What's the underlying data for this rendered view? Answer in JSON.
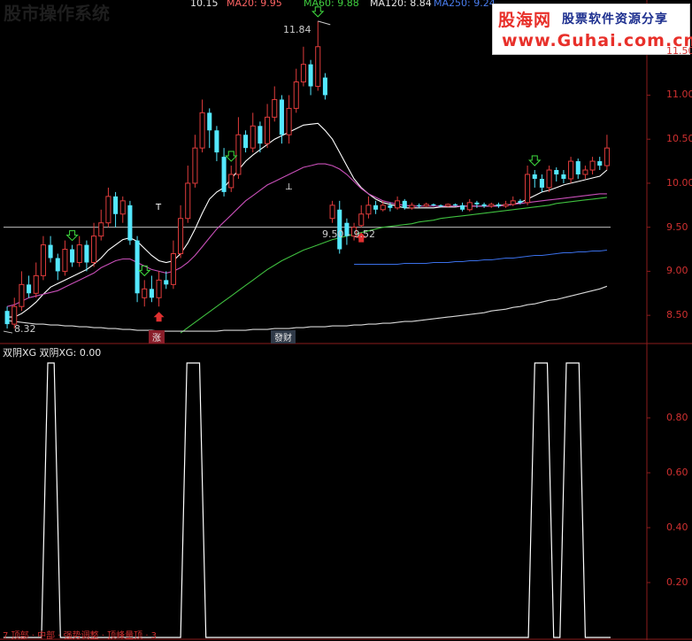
{
  "header": {
    "watermark_bg": "股市操作系统",
    "price_label": "10.15",
    "ma20": "MA20: 9.95",
    "ma60": "MA60: 9.88",
    "ma120": "MA120: 8.84",
    "ma250": "MA250: 9.24"
  },
  "logo": {
    "name": "股海网",
    "slogan": "股票软件资源分享",
    "url": "www.Guhai.com.cn"
  },
  "annotations": {
    "high_label": "11.84",
    "low_label": "8.32",
    "range_label": "9.50 - 9.52",
    "zhang_tag": "涨",
    "facai_tag": "發财",
    "t_mark": "T",
    "t_mark2": "⊥"
  },
  "lower_panel": {
    "title": "双阴XG  双阴XG: 0.00",
    "footer": "7 顶部 · 中部 · 强势调整 · 顶峰量顶 · 3"
  },
  "colors": {
    "bg": "#000000",
    "up": "#e03c3c",
    "down": "#54e8ff",
    "ma_white": "#ffffff",
    "ma_magenta": "#c84fb8",
    "ma_green": "#3fbf3f",
    "ma_blue": "#3a6fe8",
    "ma_gray": "#d8d8d8",
    "grid": "#8c1c1c",
    "tick": "#d03030",
    "arrow_green": "#3fdc3f",
    "arrow_red": "#e03030"
  },
  "chart_data": [
    {
      "type": "candlestick",
      "title": "",
      "ylim": [
        8.2,
        12.0
      ],
      "yticks": [
        8.5,
        9.0,
        9.5,
        10.0,
        10.5,
        11.0,
        11.5
      ],
      "ytick_labels": [
        "8.50",
        "9.00",
        "9.50",
        "10.00",
        "10.50",
        "11.00",
        "11.50"
      ],
      "candles": [
        [
          8.55,
          8.4,
          8.6,
          8.35
        ],
        [
          8.4,
          8.6,
          8.7,
          8.35
        ],
        [
          8.6,
          8.85,
          9.0,
          8.55
        ],
        [
          8.85,
          8.75,
          8.95,
          8.7
        ],
        [
          8.75,
          8.95,
          9.1,
          8.7
        ],
        [
          8.95,
          9.3,
          9.4,
          8.9
        ],
        [
          9.3,
          9.15,
          9.4,
          9.1
        ],
        [
          9.15,
          9.0,
          9.2,
          8.9
        ],
        [
          9.0,
          9.25,
          9.35,
          8.95
        ],
        [
          9.25,
          9.1,
          9.3,
          9.05
        ],
        [
          9.1,
          9.3,
          9.4,
          9.05
        ],
        [
          9.3,
          9.1,
          9.35,
          9.0
        ],
        [
          9.1,
          9.4,
          9.55,
          9.05
        ],
        [
          9.4,
          9.55,
          9.7,
          9.35
        ],
        [
          9.55,
          9.85,
          9.95,
          9.5
        ],
        [
          9.85,
          9.65,
          9.9,
          9.5
        ],
        [
          9.65,
          9.8,
          9.85,
          9.55
        ],
        [
          9.75,
          9.35,
          9.8,
          9.3
        ],
        [
          9.35,
          8.75,
          9.4,
          8.65
        ],
        [
          8.7,
          8.8,
          8.9,
          8.6
        ],
        [
          8.8,
          8.7,
          8.95,
          8.65
        ],
        [
          8.7,
          8.9,
          9.0,
          8.6
        ],
        [
          8.9,
          8.85,
          9.0,
          8.8
        ],
        [
          8.85,
          9.2,
          9.35,
          8.8
        ],
        [
          9.2,
          9.6,
          9.75,
          9.15
        ],
        [
          9.6,
          10.0,
          10.2,
          9.55
        ],
        [
          10.0,
          10.4,
          10.55,
          9.95
        ],
        [
          10.4,
          10.8,
          10.95,
          10.35
        ],
        [
          10.8,
          10.6,
          10.85,
          10.4
        ],
        [
          10.6,
          10.35,
          10.65,
          10.25
        ],
        [
          10.3,
          9.9,
          10.4,
          9.85
        ],
        [
          9.95,
          10.1,
          10.2,
          9.9
        ],
        [
          10.1,
          10.55,
          10.75,
          10.05
        ],
        [
          10.55,
          10.4,
          10.6,
          10.35
        ],
        [
          10.4,
          10.65,
          10.8,
          10.35
        ],
        [
          10.65,
          10.45,
          10.7,
          10.35
        ],
        [
          10.45,
          10.75,
          10.9,
          10.4
        ],
        [
          10.75,
          10.95,
          11.1,
          10.7
        ],
        [
          10.95,
          10.55,
          11.0,
          10.45
        ],
        [
          10.55,
          10.85,
          11.0,
          10.45
        ],
        [
          10.85,
          11.15,
          11.3,
          10.8
        ],
        [
          11.15,
          11.35,
          11.55,
          11.1
        ],
        [
          11.35,
          11.1,
          11.4,
          11.0
        ],
        [
          11.1,
          11.55,
          11.84,
          11.05
        ],
        [
          11.2,
          11.0,
          11.25,
          10.95
        ],
        [
          9.6,
          9.75,
          9.8,
          9.55
        ],
        [
          9.7,
          9.25,
          9.8,
          9.2
        ],
        [
          9.55,
          9.4,
          9.6,
          9.3
        ],
        [
          9.4,
          9.5,
          9.55,
          9.35
        ],
        [
          9.52,
          9.65,
          9.75,
          9.5
        ],
        [
          9.65,
          9.75,
          9.85,
          9.6
        ],
        [
          9.75,
          9.7,
          9.8,
          9.65
        ],
        [
          9.7,
          9.75,
          9.8,
          9.68
        ],
        [
          9.75,
          9.72,
          9.78,
          9.68
        ],
        [
          9.72,
          9.8,
          9.85,
          9.7
        ],
        [
          9.8,
          9.72,
          9.82,
          9.7
        ],
        [
          9.72,
          9.75,
          9.78,
          9.7
        ],
        [
          9.75,
          9.74,
          9.77,
          9.72
        ],
        [
          9.74,
          9.76,
          9.78,
          9.73
        ],
        [
          9.76,
          9.75,
          9.77,
          9.74
        ],
        [
          9.75,
          9.74,
          9.76,
          9.73
        ],
        [
          9.74,
          9.76,
          9.77,
          9.73
        ],
        [
          9.76,
          9.75,
          9.77,
          9.74
        ],
        [
          9.75,
          9.7,
          9.78,
          9.68
        ],
        [
          9.7,
          9.78,
          9.82,
          9.68
        ],
        [
          9.78,
          9.76,
          9.8,
          9.72
        ],
        [
          9.76,
          9.74,
          9.78,
          9.72
        ],
        [
          9.74,
          9.76,
          9.78,
          9.72
        ],
        [
          9.76,
          9.74,
          9.78,
          9.72
        ],
        [
          9.74,
          9.76,
          9.8,
          9.72
        ],
        [
          9.76,
          9.8,
          9.85,
          9.74
        ],
        [
          9.8,
          9.78,
          9.82,
          9.76
        ],
        [
          9.78,
          10.1,
          10.2,
          9.75
        ],
        [
          10.1,
          10.05,
          10.15,
          9.95
        ],
        [
          10.05,
          9.95,
          10.1,
          9.9
        ],
        [
          9.95,
          10.15,
          10.2,
          9.9
        ],
        [
          10.15,
          10.1,
          10.18,
          10.02
        ],
        [
          10.1,
          10.05,
          10.15,
          10.0
        ],
        [
          10.05,
          10.25,
          10.3,
          10.0
        ],
        [
          10.25,
          10.1,
          10.28,
          10.05
        ],
        [
          10.1,
          10.15,
          10.2,
          10.05
        ],
        [
          10.15,
          10.25,
          10.3,
          10.1
        ],
        [
          10.25,
          10.2,
          10.3,
          10.15
        ],
        [
          10.2,
          10.4,
          10.55,
          10.15
        ]
      ],
      "series": [
        {
          "name": "MA20",
          "values": [
            8.48,
            8.48,
            8.52,
            8.58,
            8.65,
            8.74,
            8.82,
            8.86,
            8.9,
            8.94,
            8.98,
            9.02,
            9.08,
            9.15,
            9.24,
            9.3,
            9.36,
            9.38,
            9.34,
            9.26,
            9.18,
            9.12,
            9.1,
            9.12,
            9.2,
            9.32,
            9.48,
            9.66,
            9.82,
            9.9,
            9.95,
            10.05,
            10.15,
            10.25,
            10.32,
            10.38,
            10.44,
            10.5,
            10.54,
            10.58,
            10.62,
            10.66,
            10.67,
            10.68,
            10.6,
            10.5,
            10.35,
            10.2,
            10.05,
            9.95,
            9.88,
            9.82,
            9.78,
            9.76,
            9.74,
            9.72,
            9.72,
            9.72,
            9.72,
            9.72,
            9.73,
            9.73,
            9.73,
            9.74,
            9.74,
            9.74,
            9.74,
            9.74,
            9.75,
            9.75,
            9.76,
            9.78,
            9.82,
            9.86,
            9.9,
            9.92,
            9.95,
            9.98,
            10.0,
            10.02,
            10.04,
            10.06,
            10.08,
            10.15
          ]
        },
        {
          "name": "MA60",
          "values": [
            8.6,
            8.62,
            8.66,
            8.7,
            8.72,
            8.74,
            8.76,
            8.78,
            8.82,
            8.86,
            8.9,
            8.94,
            8.98,
            9.04,
            9.08,
            9.12,
            9.14,
            9.14,
            9.1,
            9.06,
            9.02,
            9.0,
            8.98,
            9.0,
            9.04,
            9.1,
            9.18,
            9.28,
            9.38,
            9.48,
            9.56,
            9.64,
            9.72,
            9.8,
            9.86,
            9.92,
            9.98,
            10.02,
            10.06,
            10.1,
            10.14,
            10.18,
            10.2,
            10.22,
            10.22,
            10.2,
            10.16,
            10.1,
            10.02,
            9.94,
            9.88,
            9.84,
            9.8,
            9.78,
            9.76,
            9.75,
            9.74,
            9.74,
            9.74,
            9.74,
            9.74,
            9.74,
            9.74,
            9.74,
            9.74,
            9.74,
            9.74,
            9.74,
            9.74,
            9.75,
            9.76,
            9.77,
            9.78,
            9.79,
            9.8,
            9.81,
            9.82,
            9.83,
            9.84,
            9.85,
            9.86,
            9.87,
            9.88,
            9.88
          ]
        },
        {
          "name": "MA120",
          "values": [
            null,
            null,
            null,
            null,
            null,
            null,
            null,
            null,
            null,
            null,
            null,
            null,
            null,
            null,
            null,
            null,
            null,
            null,
            null,
            null,
            null,
            null,
            null,
            null,
            8.3,
            8.36,
            8.42,
            8.48,
            8.54,
            8.6,
            8.66,
            8.72,
            8.78,
            8.84,
            8.9,
            8.96,
            9.02,
            9.07,
            9.12,
            9.16,
            9.2,
            9.24,
            9.27,
            9.3,
            9.33,
            9.36,
            9.38,
            9.4,
            9.42,
            9.44,
            9.46,
            9.48,
            9.5,
            9.51,
            9.52,
            9.53,
            9.54,
            9.56,
            9.57,
            9.58,
            9.6,
            9.61,
            9.62,
            9.63,
            9.64,
            9.65,
            9.66,
            9.67,
            9.68,
            9.69,
            9.7,
            9.71,
            9.72,
            9.73,
            9.74,
            9.75,
            9.77,
            9.78,
            9.79,
            9.8,
            9.81,
            9.82,
            9.83,
            9.84
          ]
        },
        {
          "name": "MA250",
          "values": [
            null,
            null,
            null,
            null,
            null,
            null,
            null,
            null,
            null,
            null,
            null,
            null,
            null,
            null,
            null,
            null,
            null,
            null,
            null,
            null,
            null,
            null,
            null,
            null,
            null,
            null,
            null,
            null,
            null,
            null,
            null,
            null,
            null,
            null,
            null,
            null,
            null,
            null,
            null,
            null,
            null,
            null,
            null,
            null,
            null,
            null,
            null,
            null,
            9.08,
            9.08,
            9.08,
            9.08,
            9.08,
            9.08,
            9.08,
            9.09,
            9.09,
            9.09,
            9.09,
            9.1,
            9.1,
            9.1,
            9.11,
            9.11,
            9.12,
            9.12,
            9.13,
            9.13,
            9.14,
            9.15,
            9.15,
            9.16,
            9.17,
            9.18,
            9.18,
            9.19,
            9.2,
            9.21,
            9.21,
            9.22,
            9.22,
            9.23,
            9.23,
            9.24
          ]
        },
        {
          "name": "long",
          "values": [
            8.44,
            8.43,
            8.42,
            8.41,
            8.4,
            8.4,
            8.39,
            8.39,
            8.38,
            8.38,
            8.37,
            8.37,
            8.36,
            8.36,
            8.35,
            8.35,
            8.34,
            8.34,
            8.33,
            8.33,
            8.33,
            8.32,
            8.32,
            8.32,
            8.32,
            8.32,
            8.32,
            8.32,
            8.32,
            8.32,
            8.33,
            8.33,
            8.33,
            8.33,
            8.34,
            8.34,
            8.34,
            8.35,
            8.35,
            8.35,
            8.36,
            8.36,
            8.37,
            8.37,
            8.37,
            8.38,
            8.38,
            8.38,
            8.39,
            8.39,
            8.4,
            8.4,
            8.41,
            8.41,
            8.42,
            8.43,
            8.43,
            8.44,
            8.45,
            8.46,
            8.47,
            8.48,
            8.49,
            8.5,
            8.51,
            8.52,
            8.53,
            8.55,
            8.56,
            8.57,
            8.59,
            8.6,
            8.62,
            8.63,
            8.65,
            8.67,
            8.68,
            8.7,
            8.72,
            8.74,
            8.76,
            8.78,
            8.8,
            8.83
          ]
        }
      ],
      "signals_green_down": [
        9,
        19,
        31,
        43,
        73,
        94
      ],
      "signals_red_up": [
        21,
        49
      ]
    },
    {
      "type": "line",
      "title": "双阴XG",
      "ylim": [
        0,
        1.0
      ],
      "yticks": [
        0.2,
        0.4,
        0.6,
        0.8
      ],
      "ytick_labels": [
        "0.20",
        "0.40",
        "0.60",
        "0.80"
      ],
      "pulses": [
        [
          7,
          8
        ],
        [
          29,
          31
        ],
        [
          84,
          86
        ],
        [
          89,
          91
        ]
      ],
      "n": 96
    }
  ]
}
